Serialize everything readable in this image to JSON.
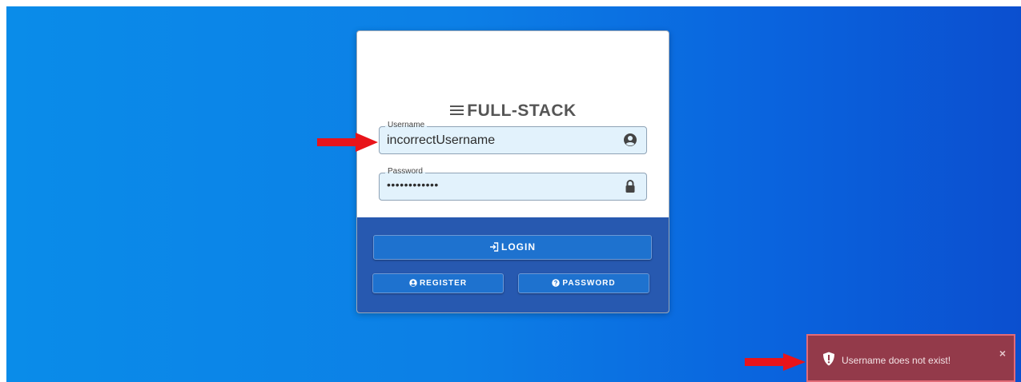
{
  "brand": {
    "title": "FULL-STACK",
    "icon": "menu-icon"
  },
  "login_form": {
    "username": {
      "label": "Username",
      "value": "incorrectUsername",
      "icon": "user-circle-icon"
    },
    "password": {
      "label": "Password",
      "value": "••••••••••••",
      "icon": "lock-icon"
    },
    "login_button": {
      "label": "LOGIN",
      "icon": "sign-in-icon"
    },
    "register_button": {
      "label": "REGISTER",
      "icon": "user-circle-icon"
    },
    "password_button": {
      "label": "PASSWORD",
      "icon": "question-circle-icon"
    }
  },
  "toast": {
    "message": "Username does not exist!",
    "icon": "shield-exclamation-icon",
    "close": "×",
    "color": "#933a4a"
  },
  "annotations": {
    "arrow_color": "#e8141a"
  },
  "colors": {
    "background": "#0a7fe6",
    "panel": "#2759b0",
    "button": "#1e72cf",
    "field": "#e2f2fc"
  }
}
